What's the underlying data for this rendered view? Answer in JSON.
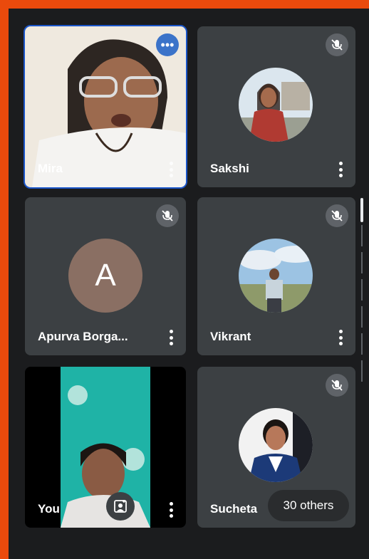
{
  "participants": [
    {
      "name": "Mira",
      "type": "video",
      "active": true
    },
    {
      "name": "Sakshi",
      "type": "photo",
      "muted": true
    },
    {
      "name": "Apurva Borga...",
      "type": "letter",
      "initial": "A",
      "avatar_color": "#8a6f63",
      "muted": true
    },
    {
      "name": "Vikrant",
      "type": "photo",
      "muted": true
    },
    {
      "name": "You",
      "type": "video"
    },
    {
      "name": "Sucheta",
      "type": "photo",
      "muted": true
    }
  ],
  "others_label": "30 others",
  "colors": {
    "border": "#ea4a0c",
    "tile": "#3c4043",
    "active_outline": "#1a55c9",
    "background": "#1b1c1e"
  }
}
